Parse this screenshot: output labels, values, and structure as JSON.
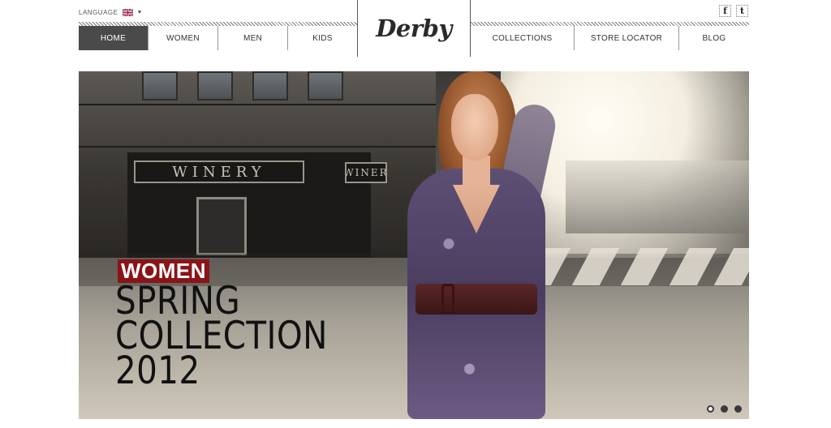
{
  "header": {
    "language_label": "LANGUAGE",
    "language_flag": "uk-flag-icon",
    "logo": "Derby",
    "nav_left": [
      "HOME",
      "WOMEN",
      "MEN",
      "KIDS"
    ],
    "nav_right": [
      "COLLECTIONS",
      "STORE LOCATOR",
      "BLOG"
    ],
    "active_nav": "HOME",
    "social": [
      {
        "icon": "facebook-icon",
        "glyph": "f"
      },
      {
        "icon": "twitter-icon",
        "glyph": "t"
      }
    ]
  },
  "hero": {
    "image": "woman-street-photo",
    "sign_main": "WINERY",
    "sign_side": "WINER",
    "tag": "WOMEN",
    "line1": "SPRING",
    "line2": "COLLECTION",
    "line3": "2012",
    "tag_color": "#8a1418",
    "slides_total": 3,
    "slide_active": 1
  },
  "colors": {
    "nav_active_bg": "#4a4a4a",
    "accent": "#8a1418"
  }
}
